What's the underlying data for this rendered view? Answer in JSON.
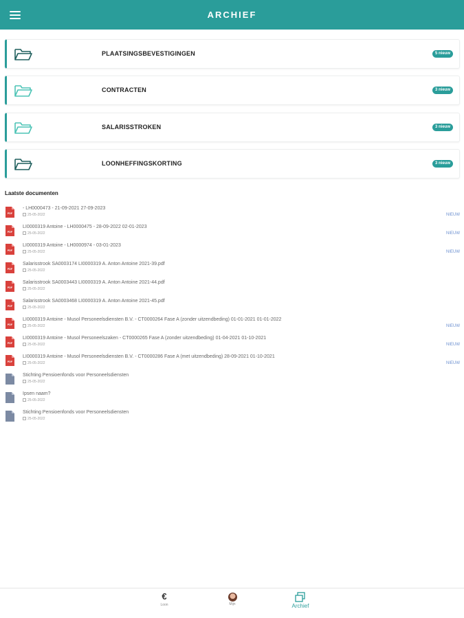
{
  "header": {
    "title": "ARCHIEF",
    "menu_icon": "hamburger-menu-icon"
  },
  "colors": {
    "accent": "#2a9d9a",
    "pdf_red": "#d9413c",
    "file_gray": "#7c8aa3",
    "new_link": "#6a8fcf"
  },
  "folders": [
    {
      "label": "PLAATSINGSBEVESTIGINGEN",
      "badge": "5 nieuw",
      "icon": "folder-open-icon"
    },
    {
      "label": "CONTRACTEN",
      "badge": "3 nieuw",
      "icon": "folder-open-icon"
    },
    {
      "label": "SALARISSTROKEN",
      "badge": "3 nieuw",
      "icon": "folder-open-icon"
    },
    {
      "label": "LOONHEFFINGSKORTING",
      "badge": "3 nieuw",
      "icon": "folder-open-icon"
    }
  ],
  "documents_section": {
    "title": "Laatste documenten"
  },
  "documents": [
    {
      "title": "- LH0000473 - 21-09-2021 27-09-2023",
      "date": "25-05-2022",
      "new": "NIEUW",
      "type": "pdf"
    },
    {
      "title": "LI0000319 Antoine - LH0000475 - 28-09-2022 02-01-2023",
      "date": "25-05-2022",
      "new": "NIEUW",
      "type": "pdf"
    },
    {
      "title": "LI0000319 Antoine - LH0000974 - 03-01-2023",
      "date": "25-05-2022",
      "new": "NIEUW",
      "type": "pdf"
    },
    {
      "title": "Salarisstrook SA0003174 LI0000319 A. Anton Antoine 2021-39.pdf",
      "date": "25-05-2022",
      "new": "",
      "type": "pdf"
    },
    {
      "title": "Salarisstrook SA0003443 LI0000319 A. Anton Antoine 2021-44.pdf",
      "date": "25-05-2022",
      "new": "",
      "type": "pdf"
    },
    {
      "title": "Salarisstrook SA0003468 LI0000319 A. Anton Antoine 2021-45.pdf",
      "date": "25-05-2022",
      "new": "",
      "type": "pdf"
    },
    {
      "title": "LI0000319 Antoine - Musol Personeelsdiensten B.V. - CT0000264 Fase A (zonder uitzendbeding) 01-01-2021 01-01-2022",
      "date": "25-05-2022",
      "new": "NIEUW",
      "type": "pdf"
    },
    {
      "title": "LI0000319 Antoine - Musol Personeelszaken - CT0000265 Fase A (zonder uitzendbeding) 01-04-2021 01-10-2021",
      "date": "25-05-2022",
      "new": "NIEUW",
      "type": "pdf"
    },
    {
      "title": "LI0000319 Antoine - Musol Personeelsdiensten B.V. - CT0000286 Fase A (met uitzendbeding) 28-09-2021 01-10-2021",
      "date": "25-05-2022",
      "new": "NIEUW",
      "type": "pdf"
    },
    {
      "title": "Stichting Pensioenfonds voor Personeelsdiensten",
      "date": "25-05-2022",
      "new": "",
      "type": "file"
    },
    {
      "title": "Ipsen naam?",
      "date": "25-05-2022",
      "new": "",
      "type": "file"
    },
    {
      "title": "Stichting Pensioenfonds voor Personeelsdiensten",
      "date": "25-05-2022",
      "new": "",
      "type": "file"
    }
  ],
  "bottom_nav": [
    {
      "label": "Loon",
      "icon": "euro-icon"
    },
    {
      "label": "Mijn",
      "icon": "avatar"
    },
    {
      "label": "Archief",
      "icon": "archive-icon",
      "active": true
    }
  ]
}
